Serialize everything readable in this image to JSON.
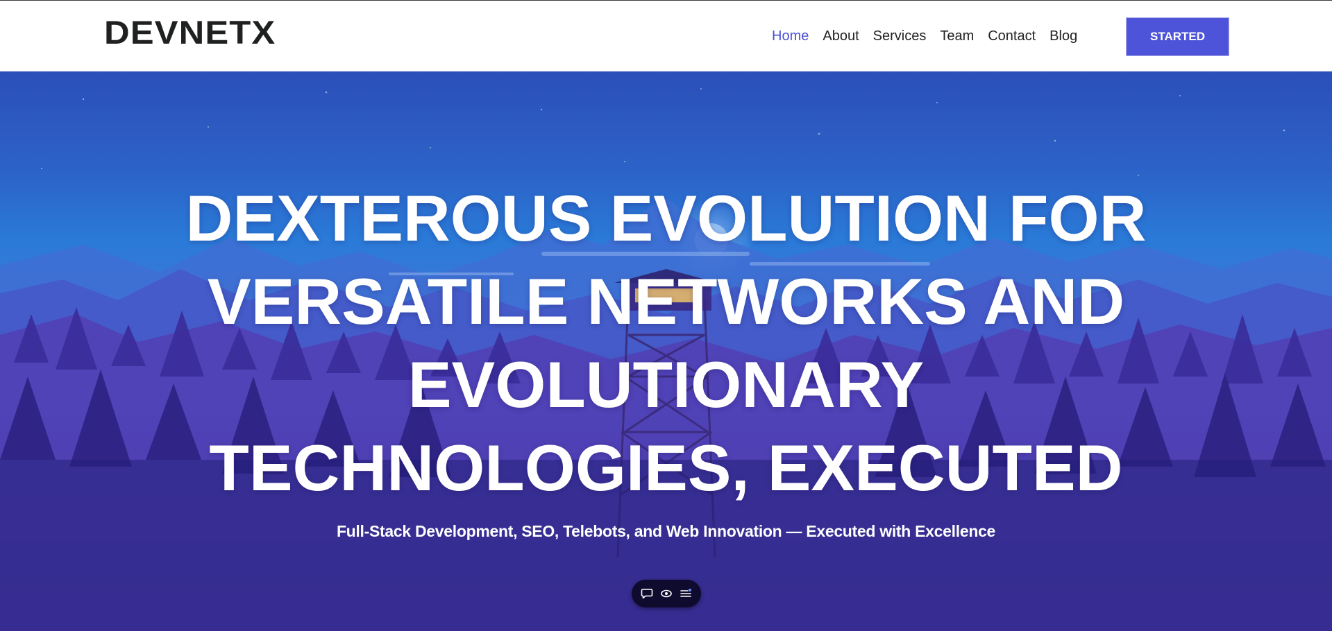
{
  "brand": {
    "logo_text": "DEVNETX"
  },
  "nav": {
    "items": [
      {
        "label": "Home",
        "active": true
      },
      {
        "label": "About",
        "active": false
      },
      {
        "label": "Services",
        "active": false
      },
      {
        "label": "Team",
        "active": false
      },
      {
        "label": "Contact",
        "active": false
      },
      {
        "label": "Blog",
        "active": false
      }
    ],
    "cta_label": "STARTED"
  },
  "hero": {
    "headline_lines": [
      "DEXTEROUS EVOLUTION FOR",
      "VERSATILE NETWORKS AND",
      "EVOLUTIONARY",
      "TECHNOLOGIES, EXECUTED"
    ],
    "subtitle": "Full-Stack Development, SEO, Telebots, and Web Innovation — Executed with Excellence"
  },
  "toolbar": {
    "icons": [
      "chat-bubble-icon",
      "eye-icon",
      "menu-list-icon"
    ]
  },
  "colors": {
    "accent": "#4e54d9",
    "nav_active": "#4a50d6",
    "hero_bottom": "#241f78",
    "hero_sky_top": "#2b4fb8",
    "hero_sky_mid": "#2a7ad8"
  }
}
